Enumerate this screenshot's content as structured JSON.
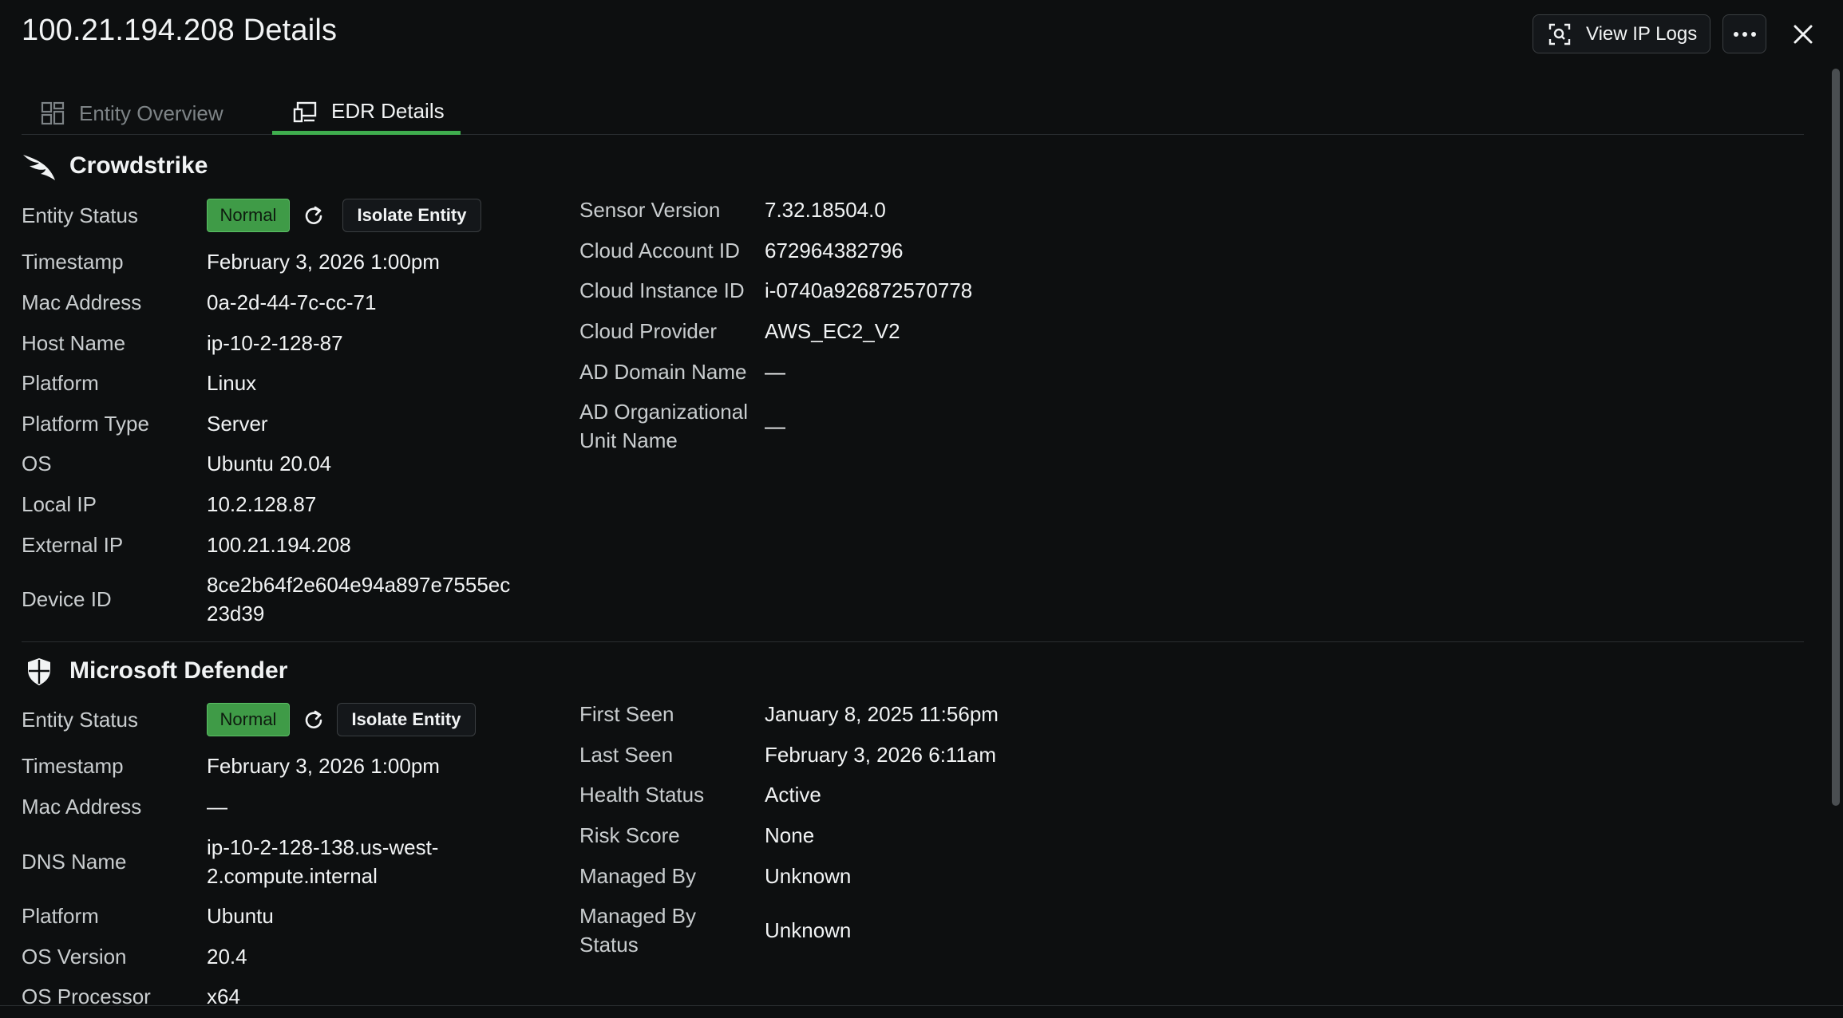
{
  "header": {
    "title": "100.21.194.208 Details",
    "view_logs_label": "View IP Logs"
  },
  "tabs": [
    {
      "label": "Entity Overview",
      "icon": "grid-icon",
      "active": false
    },
    {
      "label": "EDR Details",
      "icon": "devices-icon",
      "active": true
    }
  ],
  "crowdstrike": {
    "name": "Crowdstrike",
    "status_label": "Entity Status",
    "status": "Normal",
    "isolate_label": "Isolate Entity",
    "left": [
      {
        "label": "Timestamp",
        "value": "February 3, 2026 1:00pm"
      },
      {
        "label": "Mac Address",
        "value": "0a-2d-44-7c-cc-71"
      },
      {
        "label": "Host Name",
        "value": "ip-10-2-128-87"
      },
      {
        "label": "Platform",
        "value": "Linux"
      },
      {
        "label": "Platform Type",
        "value": "Server"
      },
      {
        "label": "OS",
        "value": "Ubuntu 20.04"
      },
      {
        "label": "Local IP",
        "value": "10.2.128.87"
      },
      {
        "label": "External IP",
        "value": "100.21.194.208"
      }
    ],
    "device_id_label": "Device ID",
    "device_id_line1": "8ce2b64f2e604e94a897e7555ec",
    "device_id_line2": "23d39",
    "right": [
      {
        "label": "Sensor Version",
        "value": "7.32.18504.0"
      },
      {
        "label": "Cloud Account ID",
        "value": "672964382796"
      },
      {
        "label": "Cloud Instance ID",
        "value": "i-0740a926872570778"
      },
      {
        "label": "Cloud Provider",
        "value": "AWS_EC2_V2"
      },
      {
        "label": "AD Domain Name",
        "value": "—"
      }
    ],
    "ad_ou_label_line1": "AD Organizational",
    "ad_ou_label_line2": "Unit Name",
    "ad_ou_value": "—"
  },
  "defender": {
    "name": "Microsoft Defender",
    "status_label": "Entity Status",
    "status": "Normal",
    "isolate_label": "Isolate Entity",
    "timestamp_label": "Timestamp",
    "timestamp": "February 3, 2026 1:00pm",
    "mac_label": "Mac Address",
    "mac": "—",
    "dns_label": "DNS Name",
    "dns_line1": "ip-10-2-128-138.us-west-",
    "dns_line2": "2.compute.internal",
    "platform_label": "Platform",
    "platform": "Ubuntu",
    "os_version_label": "OS Version",
    "os_version": "20.4",
    "os_processor_label": "OS Processor",
    "os_processor": "x64",
    "right": [
      {
        "label": "First Seen",
        "value": "January 8, 2025 11:56pm"
      },
      {
        "label": "Last Seen",
        "value": "February 3, 2026 6:11am"
      },
      {
        "label": "Health Status",
        "value": "Active"
      },
      {
        "label": "Risk Score",
        "value": "None"
      },
      {
        "label": "Managed By",
        "value": "Unknown"
      }
    ],
    "managed_status_label_line1": "Managed By",
    "managed_status_label_line2": "Status",
    "managed_status_value": "Unknown"
  },
  "colors": {
    "background": "#0d0f10",
    "accent_green": "#3fae4e",
    "badge_green": "#3f9b47"
  }
}
